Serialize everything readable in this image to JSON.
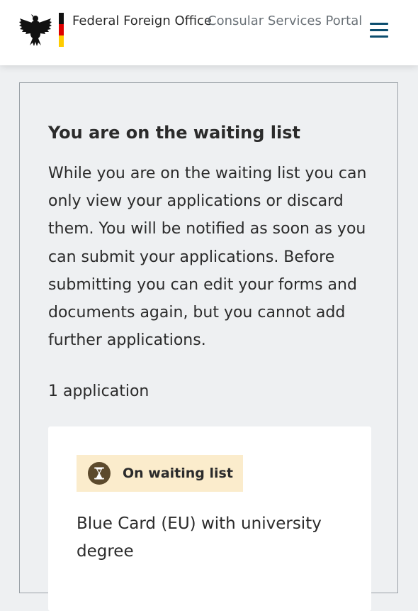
{
  "header": {
    "org_name": "Federal Foreign Office",
    "portal_name": "Consular Services Portal",
    "menu_icon": "hamburger-menu-icon",
    "logo_icon": "federal-eagle-icon",
    "flag_colors": [
      "#111111",
      "#dd0000",
      "#ffcc00"
    ]
  },
  "notice": {
    "title": "You are on the waiting list",
    "text": "While you are on the waiting list you can only view your applications or discard them. You will be notified as soon as you can submit your applications. Before submitting you can edit your forms and documents again, but you cannot add further applications."
  },
  "applications": {
    "count_label": "1 application",
    "items": [
      {
        "status": "On waiting list",
        "status_icon": "hourglass-icon",
        "status_color": "#fbeccc",
        "title": "Blue Card (EU) with university degree"
      }
    ]
  }
}
